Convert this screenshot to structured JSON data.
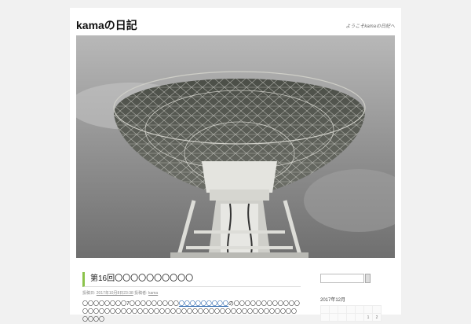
{
  "header": {
    "site_title": "kamaの日記",
    "site_description": "ようこそkamaの日記へ"
  },
  "post": {
    "title": "第16回〇〇〇〇〇〇〇〇〇〇",
    "meta_date_prefix": "投稿日:",
    "date": "2017年10月8日23:38",
    "meta_author_prefix": "投稿者:",
    "author": "kama",
    "body_before_link": "〇〇〇〇〇〇〇〇7〇〇〇〇〇〇〇〇〇",
    "body_link": "〇〇〇〇〇〇〇〇〇",
    "body_after_link": "の〇〇〇〇〇〇〇〇〇〇〇〇〇〇〇〇〇〇〇〇〇〇〇〇〇〇〇〇〇〇〇〇〇〇〇〇〇〇〇〇〇〇〇〇〇〇〇〇〇〇〇〇〇〇〇"
  },
  "sidebar": {
    "search_placeholder": "",
    "calendar_caption": "2017年12月",
    "calendar_weekdays": [
      "",
      "",
      "",
      "",
      "",
      "",
      ""
    ],
    "calendar_row1": [
      "",
      "",
      "",
      "",
      "",
      "1",
      "2"
    ]
  },
  "colors": {
    "accent_green": "#8cc34b",
    "link_blue": "#1a5aa6"
  }
}
